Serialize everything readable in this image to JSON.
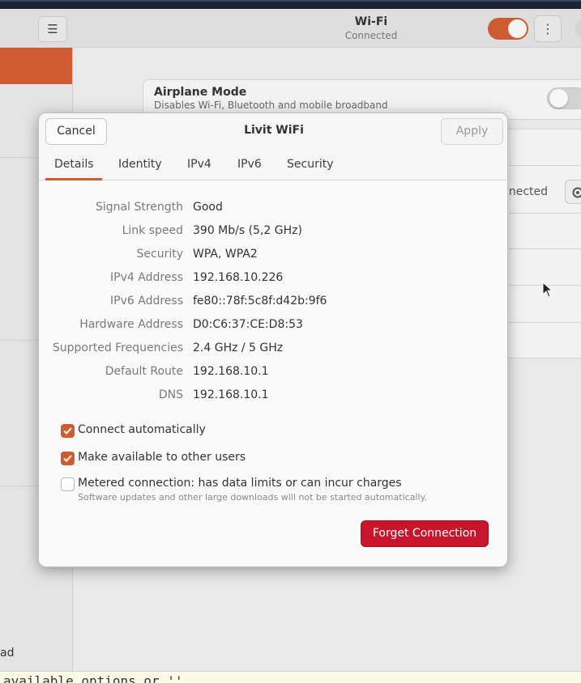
{
  "background_window": {
    "title": "Wi-Fi",
    "subtitle": "Connected",
    "menu_icon": "hamburger-menu-icon",
    "kebab_icon": "vertical-ellipsis-icon",
    "wifi_toggle_on": true,
    "airplane_mode": {
      "title": "Airplane Mode",
      "subtitle": "Disables Wi-Fi, Bluetooth and mobile broadband",
      "enabled": false
    },
    "network_status_partial": "nnected",
    "sidebar_partial_text": "ad",
    "accent_color": "#cf5b32"
  },
  "terminal_strip": {
    "text": "available options or ''"
  },
  "dialog": {
    "title": "Livit WiFi",
    "cancel_label": "Cancel",
    "apply_label": "Apply",
    "apply_enabled": false,
    "tabs": [
      {
        "label": "Details",
        "active": true
      },
      {
        "label": "Identity",
        "active": false
      },
      {
        "label": "IPv4",
        "active": false
      },
      {
        "label": "IPv6",
        "active": false
      },
      {
        "label": "Security",
        "active": false
      }
    ],
    "details": [
      {
        "label": "Signal Strength",
        "value": "Good"
      },
      {
        "label": "Link speed",
        "value": "390 Mb/s (5,2 GHz)"
      },
      {
        "label": "Security",
        "value": "WPA, WPA2"
      },
      {
        "label": "IPv4 Address",
        "value": "192.168.10.226"
      },
      {
        "label": "IPv6 Address",
        "value": "fe80::78f:5c8f:d42b:9f6"
      },
      {
        "label": "Hardware Address",
        "value": "D0:C6:37:CE:D8:53"
      },
      {
        "label": "Supported Frequencies",
        "value": "2.4 GHz / 5 GHz"
      },
      {
        "label": "Default Route",
        "value": "192.168.10.1"
      },
      {
        "label": "DNS",
        "value": "192.168.10.1"
      }
    ],
    "options": {
      "connect_automatically": {
        "label": "Connect automatically",
        "checked": true
      },
      "make_available": {
        "label": "Make available to other users",
        "checked": true
      },
      "metered": {
        "label": "Metered connection: has data limits or can incur charges",
        "sublabel": "Software updates and other large downloads will not be started automatically.",
        "checked": false
      }
    },
    "forget_label": "Forget Connection",
    "danger_color": "#c7162b"
  }
}
